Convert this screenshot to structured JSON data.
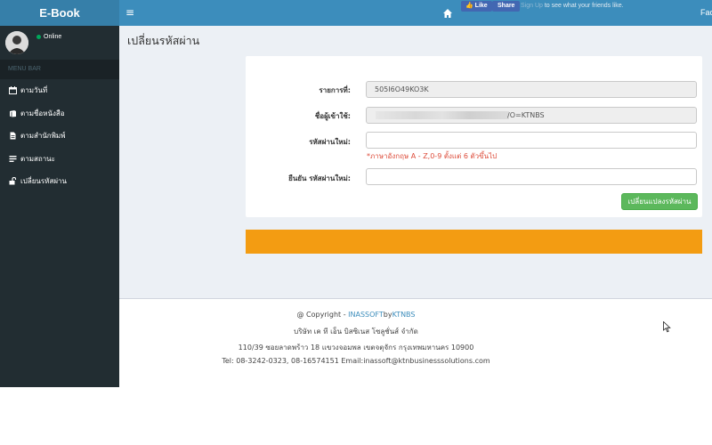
{
  "header": {
    "brand": "E-Book",
    "menu_toggle": "≡",
    "fb_like": "Like",
    "fb_share": "Share",
    "fb_signup": "Sign Up",
    "fb_text": " to see what your friends like.",
    "right_text": "Fac"
  },
  "sidebar": {
    "status": "Online",
    "menu_header": "MENU BAR",
    "items": [
      {
        "label": "ตามวันที่",
        "icon": "calendar-icon"
      },
      {
        "label": "ตามชื่อหนังสือ",
        "icon": "book-icon"
      },
      {
        "label": "ตามสำนักพิมพ์",
        "icon": "document-icon"
      },
      {
        "label": "ตามสถานะ",
        "icon": "list-icon"
      },
      {
        "label": "เปลี่ยนรหัสผ่าน",
        "icon": "unlock-icon"
      }
    ]
  },
  "page": {
    "title": "เปลี่ยนรหัสผ่าน"
  },
  "form": {
    "item_label": "รายการที่:",
    "item_value": "505I6O49KO3K",
    "username_label": "ชื่อผู้เข้าใช้:",
    "username_suffix": "/O=KTNBS",
    "new_password_label": "รหัสผ่านใหม่:",
    "new_password_value": "",
    "password_hint": "*ภาษาอังกฤษ A - Z,0-9 ตั้งแต่ 6 ตัวขึ้นไป",
    "confirm_label": "ยืนยัน รหัสผ่านใหม่:",
    "confirm_value": "",
    "submit_label": "เปลี่ยนแปลงรหัสผ่าน"
  },
  "footer": {
    "copyright_prefix": "@ Copyright - ",
    "company_link": "INASSOFT",
    "by": "by",
    "brand_link": "KTNBS",
    "company_name": "บริษัท เค ที เอ็น บิสซิเนส โซลูชั่นส์ จำกัด",
    "address": "110/39 ซอยลาดพร้าว 18 แขวงจอมพล เขตจตุจักร กรุงเทพมหานคร 10900",
    "contact": "Tel: 08-3242-0323, 08-16574151 Email:inassoft@ktnbusinesssolutions.com"
  },
  "colors": {
    "header": "#3c8dbc",
    "sidebar": "#222d32",
    "success": "#5cb85c",
    "warning": "#f39c12",
    "hint": "#dd4b39"
  }
}
